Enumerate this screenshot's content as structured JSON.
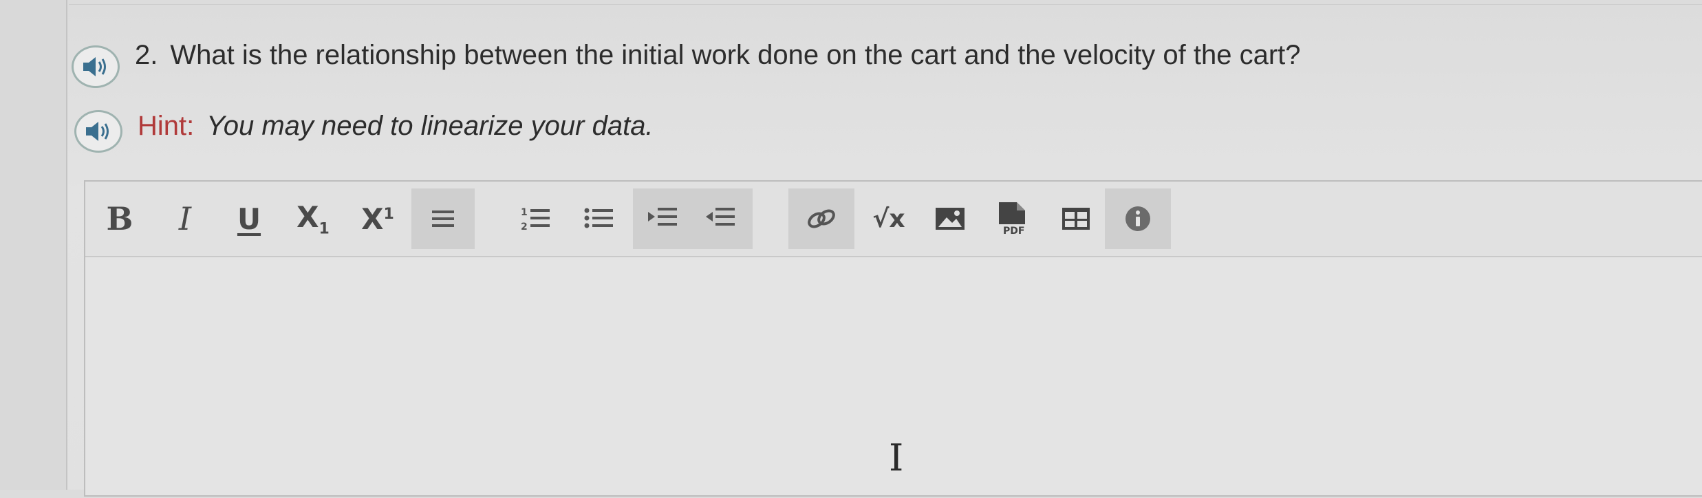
{
  "question": {
    "number": "2.",
    "text": "What is the relationship between the initial work done on the cart and the velocity of the cart?"
  },
  "hint": {
    "label": "Hint:",
    "text": "You may need to linearize your data."
  },
  "toolbar": {
    "bold": "B",
    "italic": "I",
    "underline": "U",
    "subscript_base": "X",
    "subscript_mark": "1",
    "superscript_base": "X",
    "superscript_mark": "1",
    "sqrt": "√x",
    "pdf_label": "PDF"
  },
  "colors": {
    "hint_label": "#b03a3a",
    "speaker_ring": "#9fb3b0",
    "shaded_button": "#cfcfcf"
  },
  "icons": [
    "speaker-icon",
    "align-icon",
    "ordered-list-icon",
    "unordered-list-icon",
    "indent-icon",
    "outdent-icon",
    "link-icon",
    "image-icon",
    "pdf-icon",
    "table-icon",
    "info-icon",
    "text-cursor-icon"
  ]
}
